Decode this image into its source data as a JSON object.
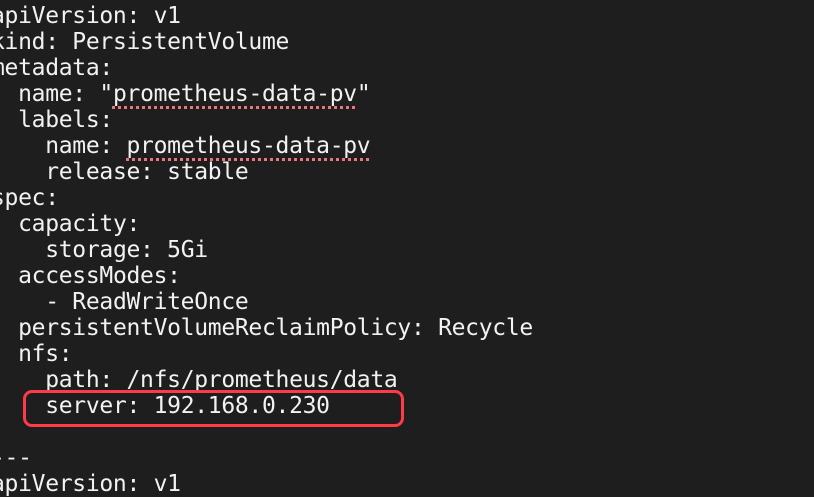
{
  "yaml_lines": [
    {
      "indent": "",
      "key": "apiVersion:",
      "value": " v1"
    },
    {
      "indent": "",
      "key": "kind:",
      "value": " PersistentVolume"
    },
    {
      "indent": "",
      "key": "metadata:",
      "value": ""
    },
    {
      "indent": "  ",
      "key": "name: ",
      "quote_open": "\"",
      "spell_value": "prometheus-data-pv",
      "quote_close": "\""
    },
    {
      "indent": "  ",
      "key": "labels:",
      "value": ""
    },
    {
      "indent": "    ",
      "key": "name: ",
      "spell_value": "prometheus-data-pv"
    },
    {
      "indent": "    ",
      "key": "release:",
      "value": " stable"
    },
    {
      "indent": "",
      "key": "spec:",
      "value": ""
    },
    {
      "indent": "  ",
      "key": "capacity:",
      "value": ""
    },
    {
      "indent": "    ",
      "key": "storage:",
      "value": " 5Gi"
    },
    {
      "indent": "  ",
      "key": "accessModes:",
      "value": ""
    },
    {
      "indent": "    ",
      "key": "- ReadWriteOnce",
      "value": ""
    },
    {
      "indent": "  ",
      "key": "persistentVolumeReclaimPolicy:",
      "value": " Recycle"
    },
    {
      "indent": "  ",
      "key": "nfs:",
      "value": ""
    },
    {
      "indent": "    ",
      "key": "path:",
      "value": " /nfs/prometheus/data"
    },
    {
      "indent": "    ",
      "key": "server:",
      "value": " 192.168.0.230"
    },
    {
      "indent": "",
      "key": "",
      "value": ""
    },
    {
      "indent": "",
      "key": "---",
      "value": ""
    },
    {
      "indent": "",
      "key": "apiVersion:",
      "value": " v1"
    }
  ],
  "colors": {
    "background": "#1e1e1e",
    "text": "#f2f2f2",
    "highlight_box": "#ff3b47",
    "spellcheck": "#e8787c"
  }
}
